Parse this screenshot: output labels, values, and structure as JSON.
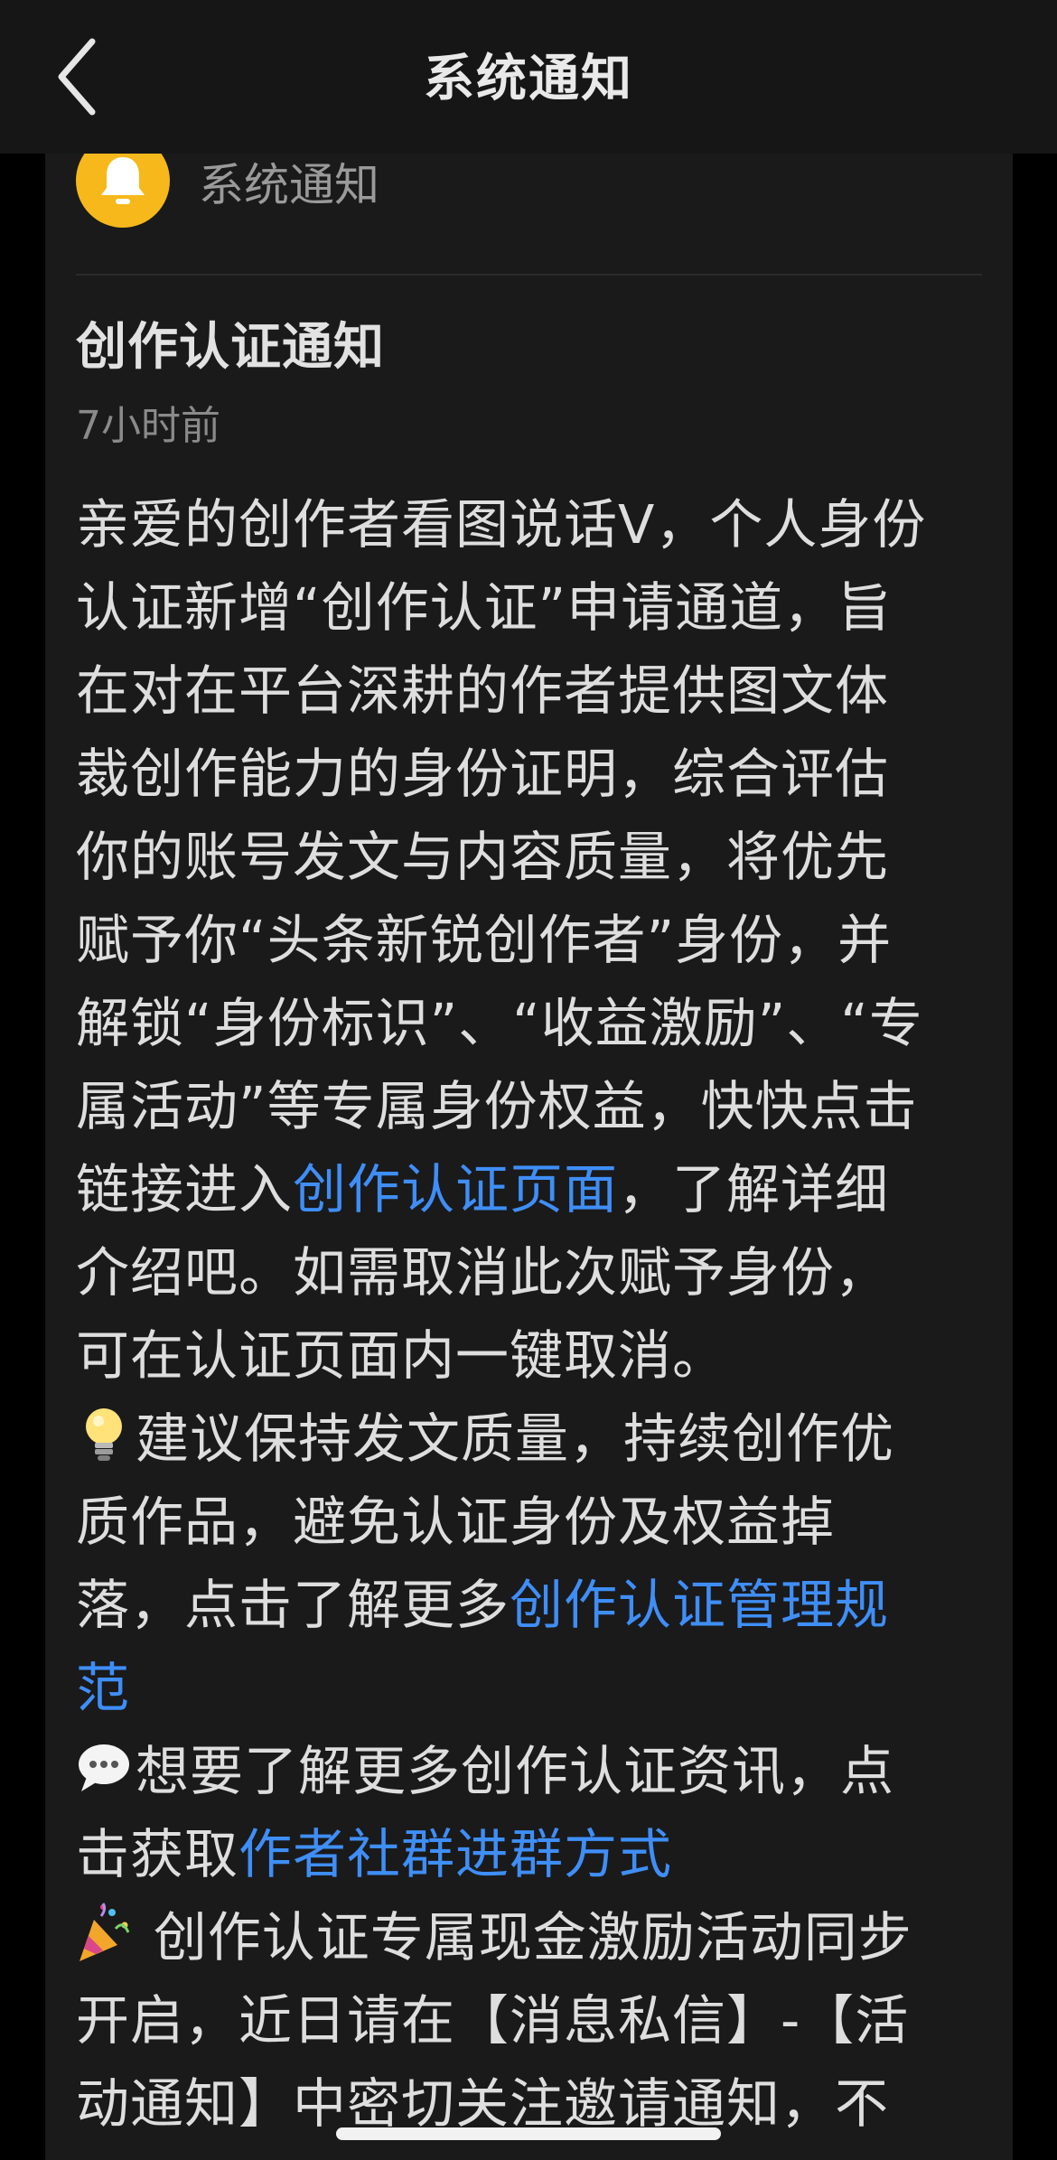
{
  "nav": {
    "title": "系统通知",
    "back_icon": "chevron-left-icon"
  },
  "sender": {
    "avatar_icon": "bell-icon",
    "avatar_color": "#f6b81b",
    "name": "系统通知"
  },
  "message": {
    "title": "创作认证通知",
    "time": "7小时前",
    "lines": {
      "l1": "亲爱的创作者看图说话V，个人身份",
      "l2": "认证新增“创作认证”申请通道，旨",
      "l3": "在对在平台深耕的作者提供图文体",
      "l4": "裁创作能力的身份证明，综合评估",
      "l5": "你的账号发文与内容质量，将优先",
      "l6": "赋予你“头条新锐创作者”身份，并",
      "l7": "解锁“身份标识”、“收益激励”、“专",
      "l8": "属活动”等专属身份权益，快快点击",
      "l9_pre": "链接进入",
      "l9_link": "创作认证页面",
      "l9_post": "，了解详细",
      "l10": "介绍吧。如需取消此次赋予身份，",
      "l11": "可在认证页面内一键取消。",
      "l12": "建议保持发文质量，持续创作优",
      "l13": "质作品，避免认证身份及权益掉",
      "l14_pre": "落，点击了解更多",
      "l14_link": "创作认证管理规",
      "l15_link": "范",
      "l16": "想要了解更多创作认证资讯，点",
      "l17_pre": "击获取",
      "l17_link": "作者社群进群方式",
      "l18": " 创作认证专属现金激励活动同步",
      "l19": "开启，近日请在【消息私信】-【活",
      "l20": "动通知】中密切关注邀请通知，不"
    },
    "emoji_icons": [
      "lightbulb-icon",
      "speech-bubble-icon",
      "party-popper-icon"
    ]
  },
  "colors": {
    "link": "#3f8ef7",
    "background": "#1a1a1a",
    "nav_background": "#161616"
  }
}
